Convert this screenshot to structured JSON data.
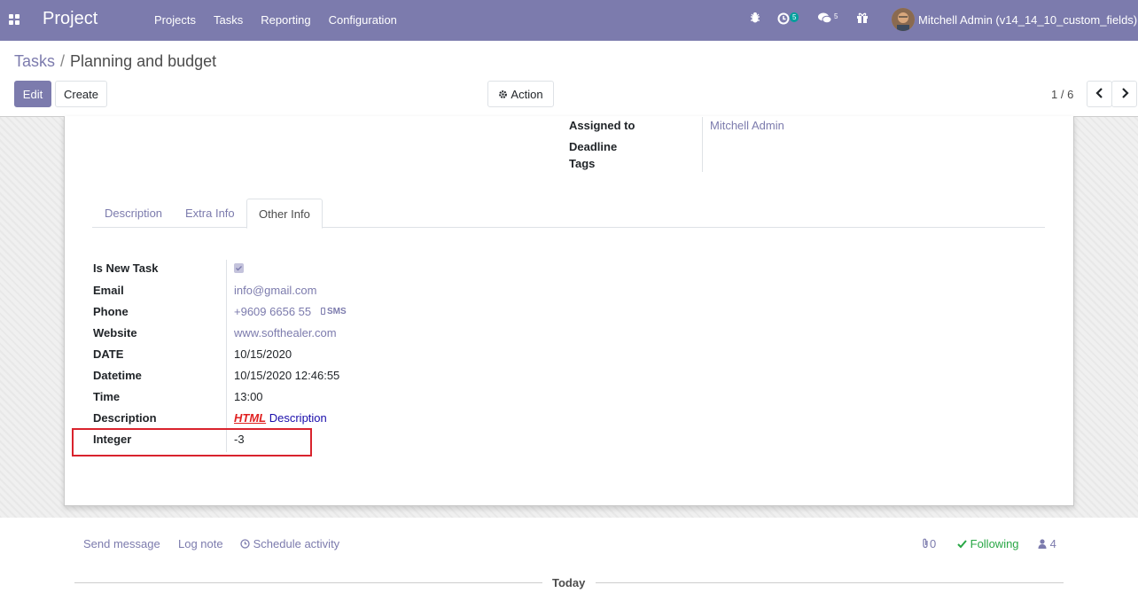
{
  "navbar": {
    "app_title": "Project",
    "menu": [
      "Projects",
      "Tasks",
      "Reporting",
      "Configuration"
    ],
    "activity_count": "5",
    "messages_count": "5",
    "user_name": "Mitchell Admin (v14_14_10_custom_fields)"
  },
  "breadcrumb": {
    "parent": "Tasks",
    "separator": "/",
    "current": "Planning and budget"
  },
  "buttons": {
    "edit": "Edit",
    "create": "Create",
    "action": "Action"
  },
  "pager": {
    "value": "1 / 6"
  },
  "top_fields": {
    "assigned_to_label": "Assigned to",
    "assigned_to_value": "Mitchell Admin",
    "deadline_label": "Deadline",
    "tags_label": "Tags"
  },
  "tabs": [
    "Description",
    "Extra Info",
    "Other Info"
  ],
  "other_info": {
    "is_new_task_label": "Is New Task",
    "is_new_task_checked": true,
    "email_label": "Email",
    "email_value": "info@gmail.com",
    "phone_label": "Phone",
    "phone_value": "+9609 6656 55",
    "sms_label": "SMS",
    "website_label": "Website",
    "website_value": "www.softhealer.com",
    "date_label": "DATE",
    "date_value": "10/15/2020",
    "datetime_label": "Datetime",
    "datetime_value": "10/15/2020 12:46:55",
    "time_label": "Time",
    "time_value": "13:00",
    "description_label": "Description",
    "description_html_word": "HTML",
    "description_rest": "Description",
    "integer_label": "Integer",
    "integer_value": "-3"
  },
  "chatter": {
    "send_message": "Send message",
    "log_note": "Log note",
    "schedule_activity": "Schedule activity",
    "attachments_count": "0",
    "following": "Following",
    "followers_count": "4",
    "today": "Today"
  },
  "colors": {
    "brand": "#7c7bad",
    "highlight_border": "#d9232d",
    "following": "#28a745"
  }
}
